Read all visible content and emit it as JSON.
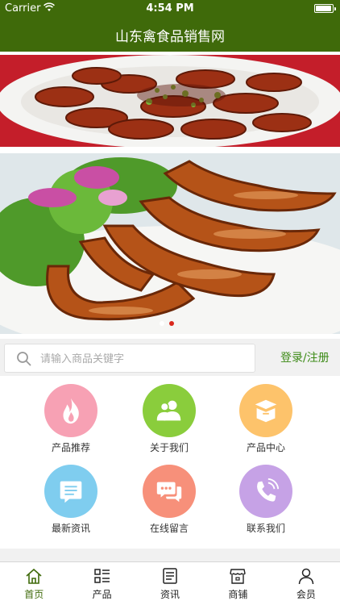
{
  "status_bar": {
    "carrier": "Carrier",
    "time": "4:54 PM"
  },
  "header": {
    "title": "山东禽食品销售网"
  },
  "banners": [
    {
      "name": "sausage-slices-banner",
      "active": false
    },
    {
      "name": "roast-sausage-banner",
      "active": true
    }
  ],
  "search": {
    "placeholder": "请输入商品关键字",
    "login_label": "登录/注册"
  },
  "grid": {
    "items": [
      {
        "label": "产品推荐",
        "icon": "flame-icon",
        "color": "#f7a1b4"
      },
      {
        "label": "关于我们",
        "icon": "users-icon",
        "color": "#8acd3c"
      },
      {
        "label": "产品中心",
        "icon": "box-icon",
        "color": "#fdc36b"
      },
      {
        "label": "最新资讯",
        "icon": "news-icon",
        "color": "#7fcdef"
      },
      {
        "label": "在线留言",
        "icon": "chat-icon",
        "color": "#f7907a"
      },
      {
        "label": "联系我们",
        "icon": "phone-icon",
        "color": "#c6a2e6"
      }
    ]
  },
  "tabs": [
    {
      "label": "首页",
      "icon": "home-icon",
      "active": true
    },
    {
      "label": "产品",
      "icon": "list-icon",
      "active": false
    },
    {
      "label": "资讯",
      "icon": "document-icon",
      "active": false
    },
    {
      "label": "商铺",
      "icon": "store-icon",
      "active": false
    },
    {
      "label": "会员",
      "icon": "person-icon",
      "active": false
    }
  ],
  "colors": {
    "brand": "#3f6a0a",
    "accent_green": "#3c8a16",
    "dot_active": "#d9271c"
  }
}
